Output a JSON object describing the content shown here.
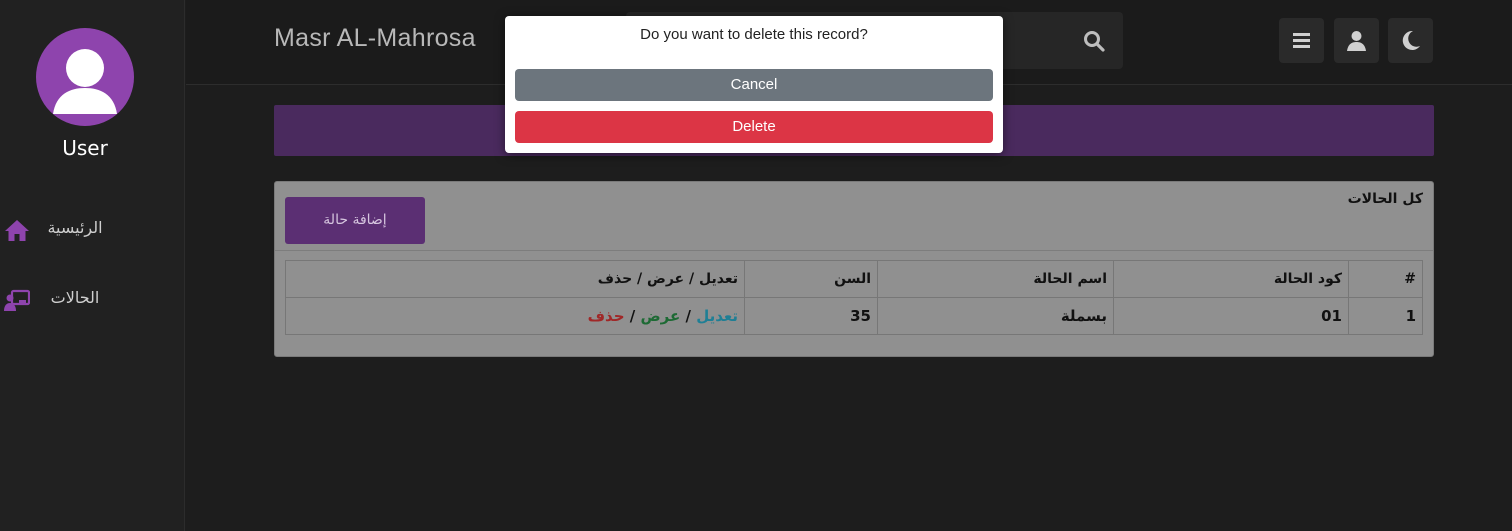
{
  "sidebar": {
    "username": "User",
    "items": [
      {
        "label": "الرئيسية",
        "icon": "home-icon"
      },
      {
        "label": "الحالات",
        "icon": "chalkboard-user-icon"
      }
    ]
  },
  "header": {
    "brand": "Masr AL-Mahrosa",
    "search_icon": "search-icon",
    "buttons": [
      "menu-icon",
      "user-icon",
      "moon-icon"
    ]
  },
  "cases_card": {
    "title": "كل الحالات",
    "add_button": "إضافة حالة",
    "columns": [
      "#",
      "كود الحالة",
      "اسم الحالة",
      "السن",
      "تعديل / عرض / حذف"
    ],
    "rows": [
      {
        "index": "1",
        "code": "01",
        "name": "بسملة",
        "age": "35",
        "edit": "تعديل",
        "view": "عرض",
        "delete": "حذف",
        "sep": "/"
      }
    ]
  },
  "modal": {
    "message": "Do you want to delete this record?",
    "cancel": "Cancel",
    "delete": "Delete"
  },
  "colors": {
    "accent": "#8e44ad",
    "banner": "#4a2a5e",
    "cancel": "#6c757d",
    "danger": "#dc3545",
    "edit_link": "#1f7f95",
    "view_link": "#1d6a34",
    "delete_link": "#a02727"
  }
}
